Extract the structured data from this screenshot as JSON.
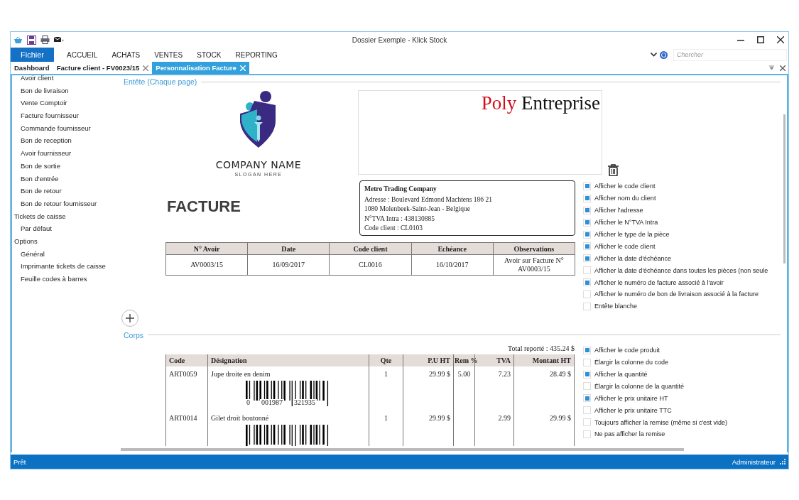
{
  "window": {
    "title": "Dossier Exemple - Klick Stock"
  },
  "menu": [
    {
      "label": "Fichier",
      "selected": true
    },
    {
      "label": "ACCUEIL",
      "selected": false
    },
    {
      "label": "ACHATS",
      "selected": false
    },
    {
      "label": "VENTES",
      "selected": false
    },
    {
      "label": "STOCK",
      "selected": false
    },
    {
      "label": "REPORTING",
      "selected": false
    }
  ],
  "search": {
    "placeholder": "Chercher"
  },
  "tabs": [
    {
      "label": "Dashboard",
      "selected": false,
      "closable": false
    },
    {
      "label": "Facture client - FV0023/15",
      "selected": false,
      "closable": true
    },
    {
      "label": "Personnalisation Facture",
      "selected": true,
      "closable": true
    }
  ],
  "sidebar": {
    "groups": [
      {
        "children": [
          {
            "label": "Avoir client"
          },
          {
            "label": "Bon de livraison"
          },
          {
            "label": "Vente Comptoir"
          },
          {
            "label": "Facture fournisseur"
          },
          {
            "label": "Commande fournisseur"
          },
          {
            "label": "Bon de reception"
          },
          {
            "label": "Avoir fournisseur"
          },
          {
            "label": "Bon de sortie"
          },
          {
            "label": "Bon d'entrée"
          },
          {
            "label": "Bon de retour"
          },
          {
            "label": "Bon de retour fournisseur"
          }
        ]
      },
      {
        "label": "Tickets de caisse",
        "children": [
          {
            "label": "Par défaut"
          }
        ]
      },
      {
        "label": "Options",
        "children": [
          {
            "label": "Général"
          },
          {
            "label": "Imprimante tickets de caisse"
          },
          {
            "label": "Feuille codes à barres"
          }
        ]
      }
    ]
  },
  "header_section": {
    "title": "Entête (Chaque page)",
    "logo": {
      "name": "COMPANY NAME",
      "slogan": "SLOGAN HERE"
    },
    "banner": {
      "highlight": "Poly",
      "rest": "Entreprise"
    },
    "document_title": "FACTURE",
    "client_box": {
      "name": "Metro Trading Company",
      "lines": [
        "Adresse : Boulevard Edmond Machtens 186 21",
        "1080 Molenbeek-Saint-Jean - Belgique",
        "N°TVA Intra : 438130885",
        "Code client : CL0103"
      ]
    },
    "info_table": {
      "columns": [
        "N° Avoir",
        "Date",
        "Code client",
        "Echéance",
        "Observations"
      ],
      "rows": [
        [
          "AV0003/15",
          "16/09/2017",
          "CL0016",
          "16/10/2017",
          "Avoir sur Facture N° AV0003/15"
        ]
      ]
    },
    "options": [
      {
        "label": "Afficher le code client",
        "checked": true
      },
      {
        "label": "Afficher nom du client",
        "checked": true
      },
      {
        "label": "Afficher l'adresse",
        "checked": true
      },
      {
        "label": "Afficher le N°TVA Intra",
        "checked": true
      },
      {
        "label": "Afficher le type de la pièce",
        "checked": true
      },
      {
        "label": "Afficher le code client",
        "checked": true
      },
      {
        "label": "Afficher la date d'échéance",
        "checked": true
      },
      {
        "label": "Afficher la date d'échéance dans toutes les pièces (non seule",
        "checked": false
      },
      {
        "label": "Afficher le numéro de facture associé à l'avoir",
        "checked": true
      },
      {
        "label": "Afficher le numéro de bon de livraison associé à la facture",
        "checked": false
      },
      {
        "label": "Entête blanche",
        "checked": false
      }
    ]
  },
  "body_section": {
    "title": "Corps",
    "total": "Total reporté : 435.24 $",
    "table": {
      "columns": [
        "Code",
        "Désignation",
        "Qte",
        "P.U HT",
        "Rem %",
        "TVA",
        "Montant HT"
      ],
      "rows": [
        {
          "cells": [
            "ART0059",
            "Jupe droite en denim",
            "1",
            "29.99 $",
            "5.00",
            "7.23",
            "28.49 $"
          ],
          "barcode": {
            "digits": [
              "0",
              "001987",
              "321935"
            ]
          }
        },
        {
          "cells": [
            "ART0014",
            "Gilet droit boutonné",
            "1",
            "29.99 $",
            null,
            "2.99",
            "29.99 $"
          ],
          "barcode": {}
        }
      ]
    },
    "options": [
      {
        "label": "Afficher le code produit",
        "checked": true
      },
      {
        "label": "Élargir la colonne du code",
        "checked": false
      },
      {
        "label": "Afficher la quantité",
        "checked": true
      },
      {
        "label": "Élargir la colonne de la quantité",
        "checked": false
      },
      {
        "label": "Afficher le prix unitaire HT",
        "checked": true
      },
      {
        "label": "Afficher le prix unitaire TTC",
        "checked": false
      },
      {
        "label": "Toujours afficher la remise (même si c'est vide)",
        "checked": false
      },
      {
        "label": "Ne pas afficher la remise",
        "checked": false
      }
    ]
  },
  "status_bar": {
    "left": "Prêt",
    "right": "Administrateur"
  }
}
